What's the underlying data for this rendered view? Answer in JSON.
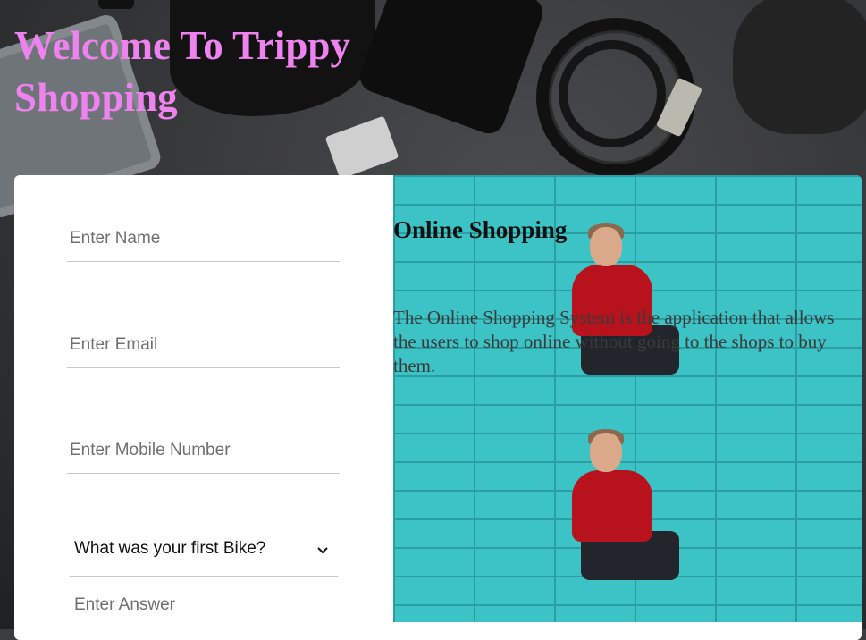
{
  "header": {
    "title_line1": "Welcome To Trippy",
    "title_line2": "Shopping"
  },
  "form": {
    "name_placeholder": "Enter Name",
    "email_placeholder": "Enter Email",
    "mobile_placeholder": "Enter Mobile Number",
    "security_question_selected": "What was your first Bike?",
    "answer_placeholder": "Enter Answer"
  },
  "promo": {
    "heading": "Online Shopping",
    "description": "The Online Shopping System is the application that allows the users to shop online without going to the shops to buy them."
  },
  "colors": {
    "title": "#ee82ee",
    "promo_bg": "#3cc3c6",
    "card_bg": "#ffffff"
  }
}
